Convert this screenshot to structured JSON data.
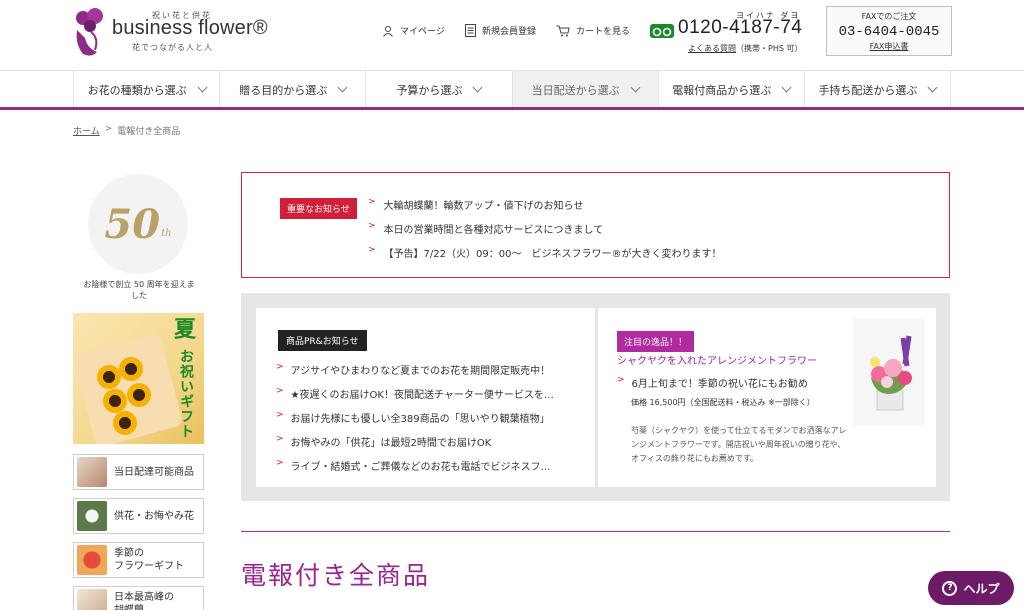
{
  "header": {
    "logo_top": "祝い花と供花",
    "logo_name": "business flower®",
    "logo_tagline": "花でつながる人と人",
    "mypage_label": "マイページ",
    "register_label": "新規会員登録",
    "cart_label": "カートを見る",
    "tel_kana": "ヨイハナ ダヨ",
    "tel_number": "0120-4187-74",
    "faq_link": "よくある質問",
    "faq_note": "（携帯・PHS 可）",
    "fax_title": "FAXでのご注文",
    "fax_number": "03-6404-0045",
    "fax_link": "FAX申込書"
  },
  "nav": {
    "items": [
      {
        "label": "お花の種類から選ぶ"
      },
      {
        "label": "贈る目的から選ぶ"
      },
      {
        "label": "予算から選ぶ"
      },
      {
        "label": "当日配送から選ぶ",
        "active": true
      },
      {
        "label": "電報付商品から選ぶ"
      },
      {
        "label": "手持ち配送から選ぶ"
      }
    ]
  },
  "breadcrumb": {
    "home": "ホーム",
    "separator": ">",
    "current": "電報付き全商品"
  },
  "sidebar": {
    "badge_number": "50",
    "badge_suffix": "th",
    "badge_caption": "お陰様で創立 50 周年を迎えました",
    "banner_kanji": "夏",
    "banner_sub": "お祝いギフト",
    "links": [
      {
        "label": "当日配達可能商品"
      },
      {
        "label": "供花・お悔やみ花"
      },
      {
        "label": "季節の\nフラワーギフト"
      },
      {
        "label": "日本最高峰の\n胡蝶蘭"
      }
    ]
  },
  "notice": {
    "tag": "重要なお知らせ",
    "items": [
      "大輪胡蝶蘭！輪数アップ・値下げのお知らせ",
      "本日の営業時間と各種対応サービスにつきまして",
      "【予告】7/22（火）09：00～　ビジネスフラワー®が大きく変わります！"
    ]
  },
  "promo": {
    "pr_tag": "商品PR&お知らせ",
    "pr_items": [
      "アジサイやひまわりなど夏までのお花を期間限定販売中！",
      "★夜遅くのお届けOK！夜間配送チャーター便サービスを…",
      "お届け先様にも優しい全389商品の「思いやり観葉植物」",
      "お悔やみの「供花」は最短2時間でお届けOK",
      "ライブ・結婚式・ご葬儀などのお花も電話でビジネスフ…"
    ],
    "hot_tag": "注目の逸品！！",
    "hot_title": "シャクヤクを入れたアレンジメントフラワー",
    "hot_line": "6月上旬まで！季節の祝い花にもお勧め",
    "hot_price": "価格 16,500円（全国配送料・税込み ※一部除く）",
    "hot_desc": "芍薬（シャクヤク）を使って仕立てるモダンでお洒落なアレンジメントフラワーです。開店祝いや周年祝いの贈り花や、オフィスの飾り花にもお薦めです。"
  },
  "page_title": "電報付き全商品",
  "help_label": "ヘルプ",
  "colors": {
    "brand_purple": "#8e2a87",
    "notice_red": "#d11f37",
    "hot_magenta": "#b02aa0",
    "tel_green": "#1a8a2a"
  }
}
